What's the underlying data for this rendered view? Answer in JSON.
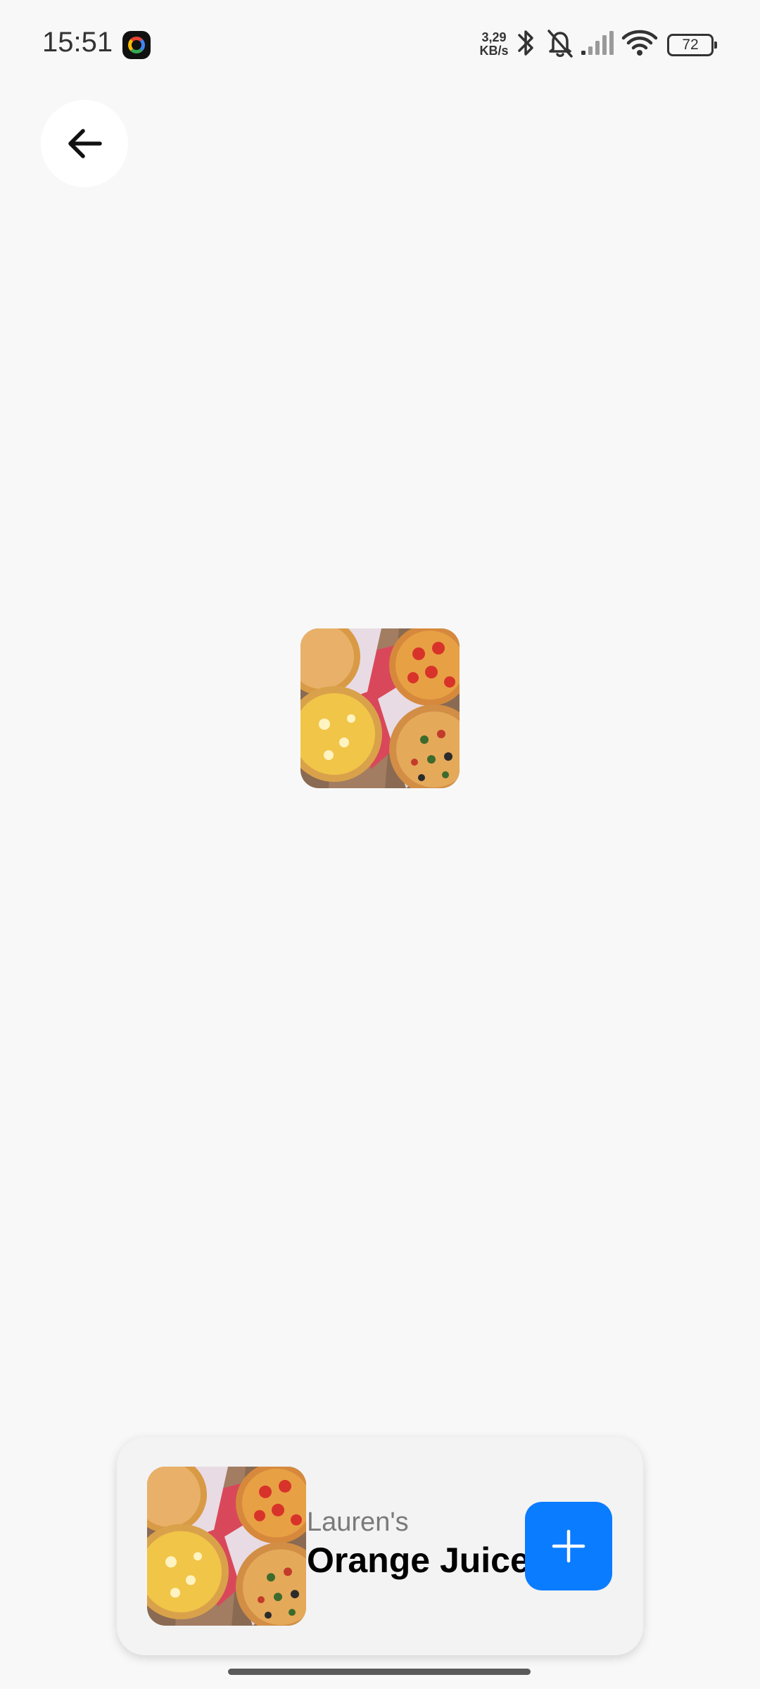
{
  "status_bar": {
    "time": "15:51",
    "net_speed_value": "3,29",
    "net_speed_unit": "KB/s",
    "battery": "72",
    "icons": [
      "google-icon",
      "bluetooth-icon",
      "bell-off-icon",
      "signal-icon",
      "wifi-icon",
      "battery-icon"
    ]
  },
  "header": {
    "back_icon": "arrow-left-icon"
  },
  "product": {
    "brand": "Lauren's",
    "name": "Orange Juice",
    "add_icon": "plus-icon"
  },
  "colors": {
    "background": "#f8f8f8",
    "card_background": "#f3f3f3",
    "accent": "#0a7cff",
    "brand_text": "#7a7a7a"
  }
}
